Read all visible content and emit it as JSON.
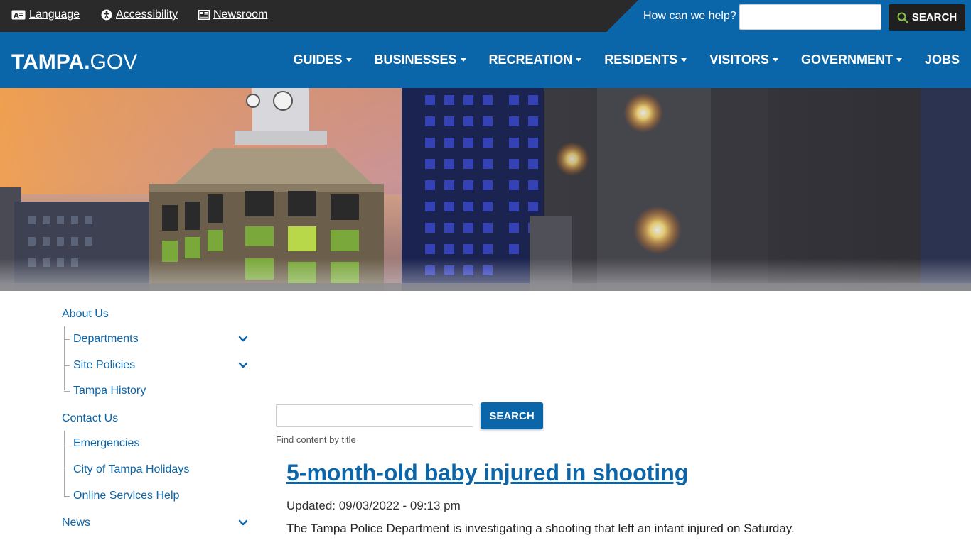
{
  "utility": {
    "language": "Language",
    "accessibility": "Accessibility",
    "newsroom": "Newsroom",
    "help_label": "How can we help?",
    "search_button": "SEARCH",
    "search_value": ""
  },
  "header": {
    "logo_bold": "TAMPA.",
    "logo_light": "GOV",
    "nav": [
      "GUIDES",
      "BUSINESSES",
      "RECREATION",
      "RESIDENTS",
      "VISITORS",
      "GOVERNMENT",
      "JOBS"
    ]
  },
  "sidebar": {
    "about": "About Us",
    "departments": "Departments",
    "site_policies": "Site Policies",
    "tampa_history": "Tampa History",
    "contact": "Contact Us",
    "emergencies": "Emergencies",
    "holidays": "City of Tampa Holidays",
    "online_help": "Online Services Help",
    "news": "News"
  },
  "main": {
    "search_button": "SEARCH",
    "search_value": "",
    "search_hint": "Find content by title",
    "article": {
      "title": "5-month-old baby injured in shooting",
      "updated": "Updated: 09/03/2022 - 09:13 pm",
      "summary": "The Tampa Police Department is investigating a shooting that left an infant injured on Saturday."
    }
  },
  "colors": {
    "brand_blue": "#0b65a9",
    "utility_bar": "#2a2a2a"
  }
}
